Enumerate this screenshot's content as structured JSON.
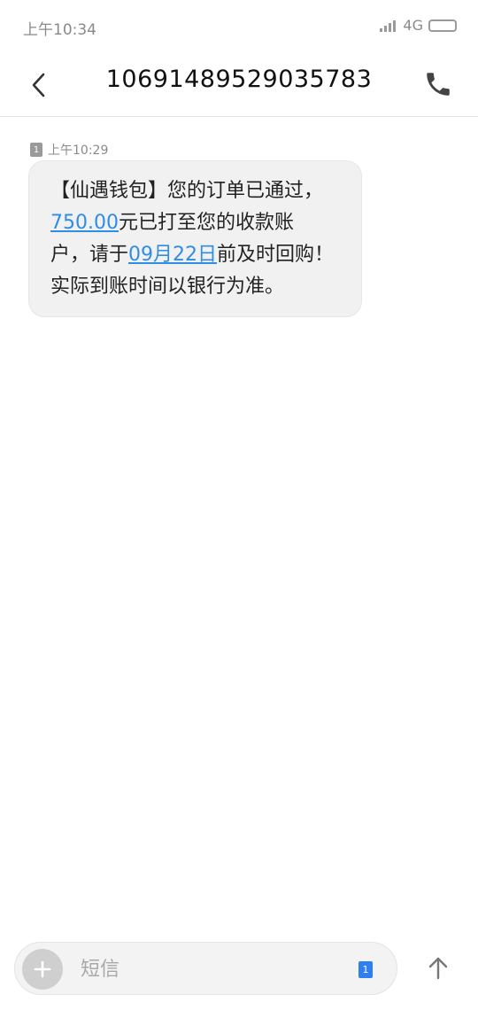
{
  "status": {
    "time": "上午10:34",
    "network": "4G",
    "signal_icon": "signal-icon",
    "battery_icon": "battery-icon"
  },
  "header": {
    "back_icon": "chevron-left-icon",
    "title": "10691489529035783",
    "call_icon": "phone-icon"
  },
  "message": {
    "sim": "1",
    "time": "上午10:29",
    "lines": [
      {
        "text": "【仙遇钱包】您的订单已通过，"
      },
      {
        "link": "750.00",
        "after": "元已打至您的收款账"
      },
      {
        "before": "户，请于",
        "link": "09月22日",
        "after": "前及时回购！"
      },
      {
        "text": "实际到账时间以银行为准。"
      }
    ]
  },
  "composer": {
    "add_icon": "plus-icon",
    "placeholder": "短信",
    "sim": "1",
    "send_icon": "arrow-up-icon"
  },
  "colors": {
    "link": "#2f8de4",
    "bubble": "#f1f1f1",
    "sim_active": "#2f7ff0"
  }
}
